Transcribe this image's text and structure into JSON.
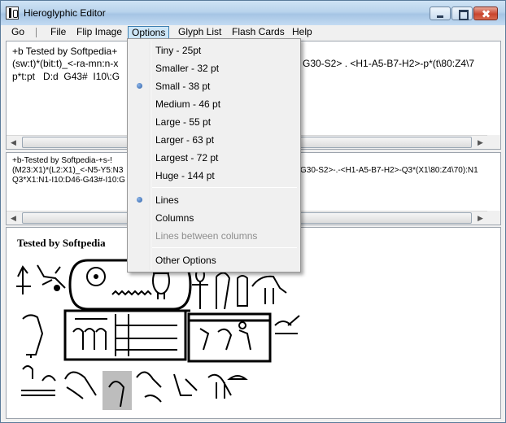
{
  "window": {
    "title": "Hieroglyphic Editor"
  },
  "menubar": {
    "items": [
      {
        "label": "Go",
        "active": false
      },
      {
        "label": "File",
        "active": false
      },
      {
        "label": "Flip Image",
        "active": false
      },
      {
        "label": "Options",
        "active": true
      },
      {
        "label": "Glyph List",
        "active": false
      },
      {
        "label": "Flash Cards",
        "active": false
      },
      {
        "label": "Help",
        "active": false
      }
    ]
  },
  "editor": {
    "line1": "+b Tested by Softpedia+",
    "line2_left": "(sw:t)*(bit:t)_<-ra-mn:n-x",
    "line2_right": "G30-S2> . <H1-A5-B7-H2>-p*(t\\80:Z4\\7",
    "line3": "p*t:pt   D:d  G43#  I10\\:G"
  },
  "encoding": {
    "line1": "+b-Tested by Softpedia-+s-!",
    "line2_left": "(M23:X1)*(L2:X1)_<-N5-Y5:N3",
    "line2_right": "G30-S2>-.-<H1-A5-B7-H2>-Q3*(X1\\80:Z4\\70):N1",
    "line3": "Q3*X1:N1-I10:D46-G43#-I10:G"
  },
  "preview": {
    "title": "Tested by Softpedia"
  },
  "options_menu": {
    "items": [
      {
        "label": "Tiny - 25pt",
        "checked": false,
        "disabled": false
      },
      {
        "label": "Smaller - 32 pt",
        "checked": false,
        "disabled": false
      },
      {
        "label": "Small - 38 pt",
        "checked": true,
        "disabled": false
      },
      {
        "label": "Medium - 46 pt",
        "checked": false,
        "disabled": false
      },
      {
        "label": "Large - 55 pt",
        "checked": false,
        "disabled": false
      },
      {
        "label": "Larger - 63 pt",
        "checked": false,
        "disabled": false
      },
      {
        "label": "Largest - 72 pt",
        "checked": false,
        "disabled": false
      },
      {
        "label": "Huge - 144 pt",
        "checked": false,
        "disabled": false
      },
      {
        "label": "Lines",
        "checked": true,
        "disabled": false
      },
      {
        "label": "Columns",
        "checked": false,
        "disabled": false
      },
      {
        "label": "Lines between columns",
        "checked": false,
        "disabled": true
      },
      {
        "label": "Other Options",
        "checked": false,
        "disabled": false
      }
    ]
  },
  "colors": {
    "menu_highlight": "#cde6f7",
    "menu_highlight_border": "#3c7fb1",
    "disabled_text": "#8d8d8d"
  }
}
